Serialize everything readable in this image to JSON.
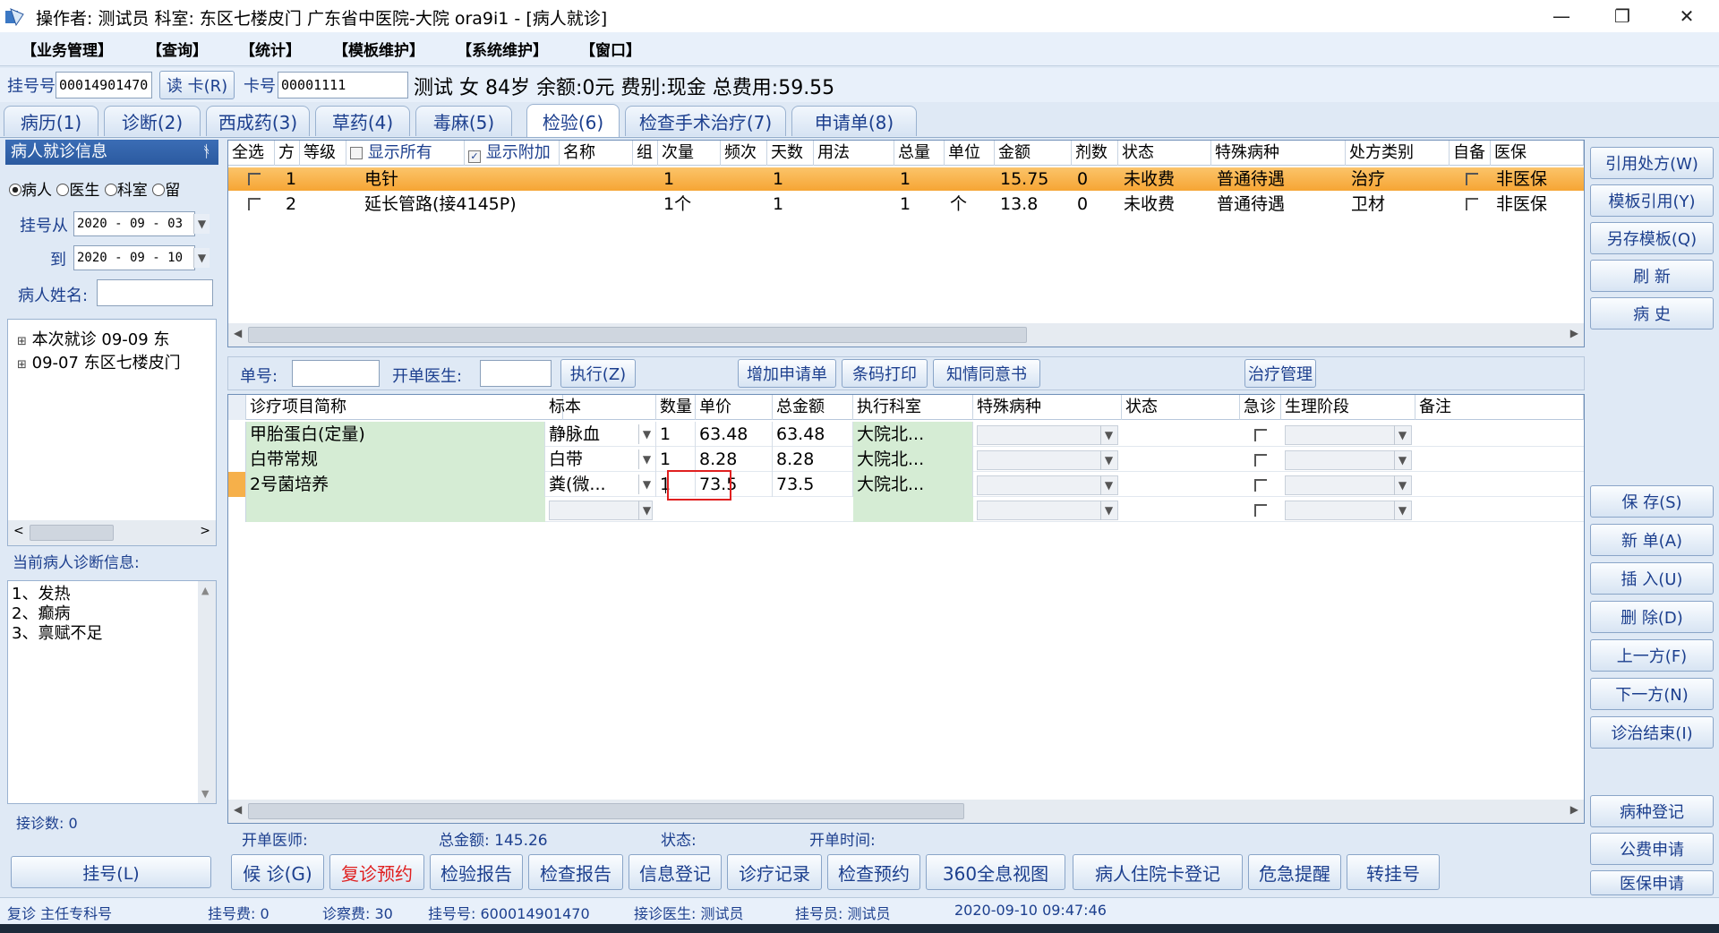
{
  "window": {
    "title": "操作者: 测试员  科室: 东区七楼皮门  广东省中医院-大院 ora9i1 - [病人就诊]",
    "minimize": "—",
    "restore": "❐",
    "close": "✕"
  },
  "menu": [
    "【业务管理】",
    "【查询】",
    "【统计】",
    "【模板维护】",
    "【系统维护】",
    "【窗口】"
  ],
  "patient": {
    "reg_label": "挂号号",
    "reg_no": "00014901470",
    "read_card": "读 卡(R)",
    "card_label": "卡号",
    "card_no": "00001111",
    "summary": "测试 女 84岁 余额:0元 费别:现金 总费用:59.55"
  },
  "tabs": [
    "病历(1)",
    "诊断(2)",
    "西成药(3)",
    "草药(4)",
    "毒麻(5)",
    "检验(6)",
    "检查手术治疗(7)",
    "申请单(8)"
  ],
  "left": {
    "header": "病人就诊信息",
    "pin": "ᚬ",
    "radio": [
      "病人",
      "医生",
      "科室",
      "留"
    ],
    "date_from_label": "挂号从",
    "date_from": "2020 - 09 - 03",
    "date_to_label": "到",
    "date_to": "2020 - 09 - 10",
    "name_label": "病人姓名:",
    "tree": [
      "本次就诊 09-09 东",
      "09-07 东区七楼皮门"
    ],
    "diag_header": "当前病人诊断信息:",
    "diagnoses": [
      "1、发热",
      "2、癫病",
      "3、禀赋不足"
    ],
    "count_label": "接诊数: 0",
    "register_btn": "挂号(L)"
  },
  "rx_grid": {
    "headers": [
      "全选",
      "方",
      "等级",
      "显示所有",
      "显示附加",
      "名称",
      "组",
      "次量",
      "频次",
      "天数",
      "用法",
      "总量",
      "单位",
      "金额",
      "剂数",
      "状态",
      "特殊病种",
      "处方类别",
      "自备",
      "医保"
    ],
    "rows": [
      {
        "fang": "1",
        "name": "电针",
        "dose": "1",
        "freq": "1",
        "total": "1",
        "unit": "",
        "amount": "15.75",
        "doses": "0",
        "status": "未收费",
        "special": "普通待遇",
        "category": "治疗",
        "insurance": "非医保"
      },
      {
        "fang": "2",
        "name": "延长管路(接4145P)",
        "dose": "1个",
        "freq": "1",
        "total": "1",
        "unit": "个",
        "amount": "13.8",
        "doses": "0",
        "status": "未收费",
        "special": "普通待遇",
        "category": "卫材",
        "insurance": "非医保"
      }
    ]
  },
  "toolbar2": {
    "order_label": "单号:",
    "doctor_label": "开单医生:",
    "execute": "执行(Z)",
    "add_request": "增加申请单",
    "barcode": "条码打印",
    "consent": "知情同意书",
    "treatment": "治疗管理"
  },
  "lab_grid": {
    "headers": [
      "诊疗项目简称",
      "标本",
      "数量",
      "单价",
      "总金额",
      "执行科室",
      "特殊病种",
      "状态",
      "急诊",
      "生理阶段",
      "备注"
    ],
    "rows": [
      {
        "item": "甲胎蛋白(定量)",
        "specimen": "静脉血",
        "qty": "1",
        "price": "63.48",
        "total": "63.48",
        "dept": "大院北..."
      },
      {
        "item": "白带常规",
        "specimen": "白带",
        "qty": "1",
        "price": "8.28",
        "total": "8.28",
        "dept": "大院北..."
      },
      {
        "item": "2号菌培养",
        "specimen": "粪(微...",
        "qty": "1",
        "price": "73.5",
        "total": "73.5",
        "dept": "大院北..."
      }
    ]
  },
  "footer_info": {
    "doctor_label": "开单医师:",
    "total_label": "总金额: 145.26",
    "status_label": "状态:",
    "time_label": "开单时间:"
  },
  "right_buttons_top": [
    "引用处方(W)",
    "模板引用(Y)",
    "另存模板(Q)",
    "刷 新",
    "病 史"
  ],
  "right_buttons_mid": [
    "保 存(S)",
    "新 单(A)",
    "插 入(U)",
    "删 除(D)",
    "上一方(F)",
    "下一方(N)",
    "诊治结束(I)"
  ],
  "right_buttons_bot": [
    "病种登记",
    "公费申请",
    "医保申请"
  ],
  "bottom_buttons": [
    "候 诊(G)",
    "复诊预约",
    "检验报告",
    "检查报告",
    "信息登记",
    "诊疗记录",
    "检查预约",
    "360全息视图",
    "病人住院卡登记",
    "危急提醒",
    "转挂号"
  ],
  "statusbar": {
    "type": "复诊 主任专科号",
    "reg_fee": "挂号费:  0",
    "diag_fee": "诊察费: 30",
    "reg_no": "挂号号:  600014901470",
    "doctor": "接诊医生:  测试员",
    "registrar": "挂号员: 测试员",
    "datetime": "2020-09-10 09:47:46"
  },
  "colors": {
    "selected_row": "#f9b045",
    "green_cell": "#d5ecd4",
    "accent": "#1c3f8e",
    "red_text": "#e02020"
  }
}
